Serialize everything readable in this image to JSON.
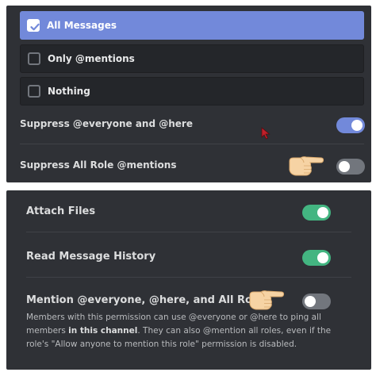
{
  "notifications": {
    "options": [
      {
        "label": "All Messages",
        "checked": true
      },
      {
        "label": "Only @mentions",
        "checked": false
      },
      {
        "label": "Nothing",
        "checked": false
      }
    ],
    "suppress_everyone": {
      "label": "Suppress @everyone and @here",
      "enabled": true
    },
    "suppress_roles": {
      "label": "Suppress All Role @mentions",
      "enabled": false
    }
  },
  "permissions": {
    "attach_files": {
      "label": "Attach Files",
      "enabled": true
    },
    "read_history": {
      "label": "Read Message History",
      "enabled": true
    },
    "mention_everyone": {
      "label": "Mention @everyone, @here, and All Roles",
      "enabled": false,
      "description_part1": "Members with this permission can use @everyone or @here to ping all members ",
      "description_bold": "in this channel",
      "description_part2": ". They can also @mention all roles, even if the role's \"Allow anyone to mention this role\" permission is disabled."
    }
  },
  "colors": {
    "panel_bg": "#2f3136",
    "accent_blurple": "#7289da",
    "toggle_green": "#43b581",
    "toggle_off": "#72767d"
  },
  "icons": [
    "checkmark-icon",
    "pointing-hand-icon",
    "mouse-cursor-icon"
  ]
}
